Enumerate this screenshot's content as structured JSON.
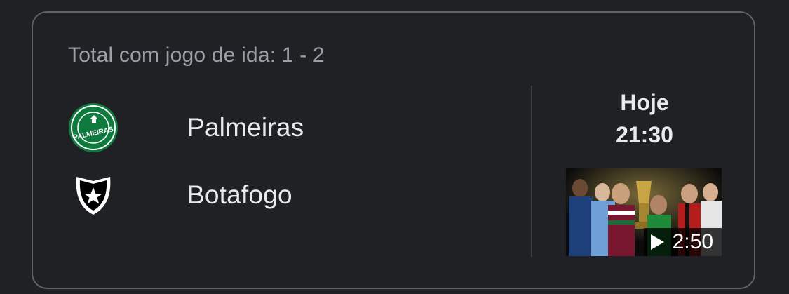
{
  "match": {
    "aggregate_label": "Total com jogo de ida: 1 - 2",
    "home_team": {
      "name": "Palmeiras",
      "logo_icon": "palmeiras-crest-icon",
      "logo_text": "PALMEIRAS",
      "logo_color": "#0f7a3e"
    },
    "away_team": {
      "name": "Botafogo",
      "logo_icon": "botafogo-star-shield-icon",
      "logo_color": "#ffffff"
    },
    "day": "Hoje",
    "time": "21:30",
    "video": {
      "duration": "2:50",
      "play_icon": "play-icon"
    }
  },
  "colors": {
    "background": "#202124",
    "border": "#5f6368",
    "muted_text": "#9aa0a6",
    "primary_text": "#e8eaed"
  }
}
